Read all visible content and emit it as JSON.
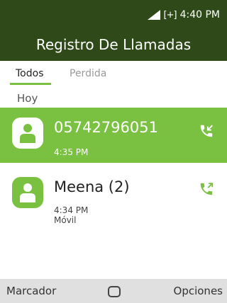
{
  "status_bar": {
    "battery": "[+]",
    "time": "4:40 PM"
  },
  "header": {
    "title": "Registro De Llamadas"
  },
  "tabs": [
    {
      "label": "Todos",
      "active": true
    },
    {
      "label": "Perdida",
      "active": false
    }
  ],
  "section": {
    "label": "Hoy"
  },
  "calls": [
    {
      "name": "05742796051",
      "time": "4:35 PM",
      "type": "",
      "direction": "incoming",
      "icon": "incoming-call-icon",
      "selected": true
    },
    {
      "name": "Meena (2)",
      "time": "4:34 PM",
      "type": "Móvil",
      "direction": "outgoing",
      "icon": "outgoing-call-icon",
      "selected": false
    }
  ],
  "softkeys": {
    "left": "Marcador",
    "center_icon": "select-circle-icon",
    "right": "Opciones"
  },
  "colors": {
    "header_bg": "#2f4a18",
    "accent": "#7ac142",
    "softkey_bg": "#e0e0e0"
  }
}
